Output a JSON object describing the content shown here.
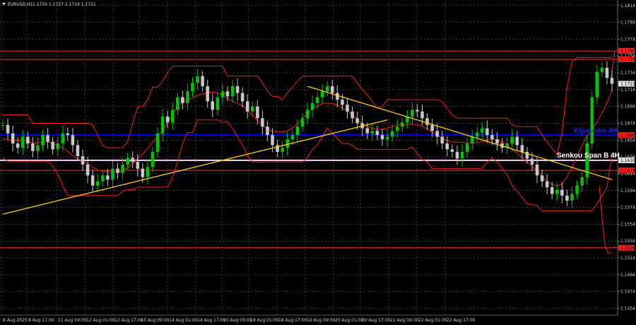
{
  "header": {
    "symbol": "EURUSD,H1",
    "ohlc": "1.1720 1.1727 1.1719 1.1721"
  },
  "colors": {
    "background": "#000000",
    "grid": "#7a7a7a",
    "bull_candle": "#00c400",
    "bear_candle": "#c8c8c8",
    "ichimoku": "#ff1a1a",
    "trendline": "#ffcc00",
    "kijun": "#0000ff",
    "senkou": "#ffd2ff",
    "level": "#ff2a2a",
    "price_tag": "#e8e8e8"
  },
  "annotations": {
    "kijun_label": "Kijun-sen 4H",
    "senkou_label": "Senkou Span B 4H"
  },
  "chart_data": {
    "type": "candlestick",
    "title": "EURUSD,H1",
    "ylim": [
      1.1446,
      1.1818
    ],
    "y_ticks": [
      "1.1814",
      "1.1794",
      "1.1774",
      "1.1754",
      "1.1734",
      "1.1714",
      "1.1694",
      "1.1674",
      "1.1654",
      "1.1634",
      "1.1614",
      "1.1594",
      "1.1574",
      "1.1554",
      "1.1534",
      "1.1514",
      "1.1494",
      "1.1474",
      "1.1454"
    ],
    "x_ticks": [
      "8 Aug 2025",
      "8 Aug 17:00",
      "11 Aug 09:00",
      "12 Aug 01:00",
      "12 Aug 17:00",
      "13 Aug 09:00",
      "14 Aug 01:00",
      "14 Aug 17:00",
      "15 Aug 09:00",
      "18 Aug 01:00",
      "18 Aug 17:00",
      "19 Aug 09:00",
      "20 Aug 01:00",
      "20 Aug 17:00",
      "21 Aug 09:00",
      "22 Aug 01:00",
      "22 Aug 17:00"
    ],
    "price_series": [
      1.1672,
      1.1662,
      1.165,
      1.1645,
      1.1658,
      1.165,
      1.1641,
      1.1648,
      1.166,
      1.1652,
      1.1643,
      1.165,
      1.1662,
      1.166,
      1.1648,
      1.1635,
      1.1625,
      1.1612,
      1.16,
      1.1605,
      1.1612,
      1.1607,
      1.162,
      1.1615,
      1.1625,
      1.1633,
      1.1628,
      1.162,
      1.161,
      1.1622,
      1.164,
      1.1662,
      1.1682,
      1.1675,
      1.169,
      1.1705,
      1.1698,
      1.1712,
      1.1722,
      1.173,
      1.1718,
      1.17,
      1.169,
      1.1705,
      1.1712,
      1.1706,
      1.1718,
      1.171,
      1.17,
      1.1688,
      1.1694,
      1.168,
      1.167,
      1.166,
      1.1648,
      1.164,
      1.1645,
      1.1655,
      1.166,
      1.167,
      1.168,
      1.169,
      1.1698,
      1.1705,
      1.1712,
      1.1718,
      1.171,
      1.1702,
      1.1696,
      1.1688,
      1.168,
      1.1674,
      1.1668,
      1.1662,
      1.1665,
      1.166,
      1.1655,
      1.1658,
      1.1665,
      1.167,
      1.1675,
      1.1682,
      1.169,
      1.1688,
      1.168,
      1.1672,
      1.1665,
      1.1658,
      1.165,
      1.1643,
      1.164,
      1.1632,
      1.164,
      1.165,
      1.1658,
      1.1663,
      1.1668,
      1.166,
      1.1655,
      1.165,
      1.1645,
      1.165,
      1.1658,
      1.1648,
      1.164,
      1.1632,
      1.1625,
      1.1612,
      1.1605,
      1.1598,
      1.159,
      1.1595,
      1.1588,
      1.1582,
      1.159,
      1.16,
      1.161,
      1.165,
      1.1705,
      1.1735,
      1.174,
      1.1728,
      1.1721
    ],
    "kijun_level": 1.166,
    "senkou_level": 1.163,
    "red_levels": [
      1.176,
      1.175,
      1.1618,
      1.1526
    ],
    "price_tags": [
      {
        "label": "1.1760",
        "value": 1.176,
        "color": "#ff1a1a"
      },
      {
        "label": "1.1750",
        "value": 1.175,
        "color": "#ff1a1a"
      },
      {
        "label": "1.1721",
        "value": 1.1721,
        "color": "#e8e8e8"
      },
      {
        "label": "1.1660",
        "value": 1.166,
        "color": "#ff1a1a"
      },
      {
        "label": "1.1630",
        "value": 1.163,
        "color": "#e8e8e8"
      },
      {
        "label": "1.1618",
        "value": 1.1618,
        "color": "#ff1a1a"
      },
      {
        "label": "1.1526",
        "value": 1.1526,
        "color": "#ff1a1a"
      }
    ],
    "trendlines": [
      {
        "name": "support-trendline",
        "from": {
          "index": 0,
          "price": 1.1566
        },
        "to": {
          "index": 77,
          "price": 1.1678
        }
      },
      {
        "name": "resistance-trendline",
        "from": {
          "index": 61,
          "price": 1.1718
        },
        "to": {
          "index": 122,
          "price": 1.1607
        }
      }
    ]
  }
}
